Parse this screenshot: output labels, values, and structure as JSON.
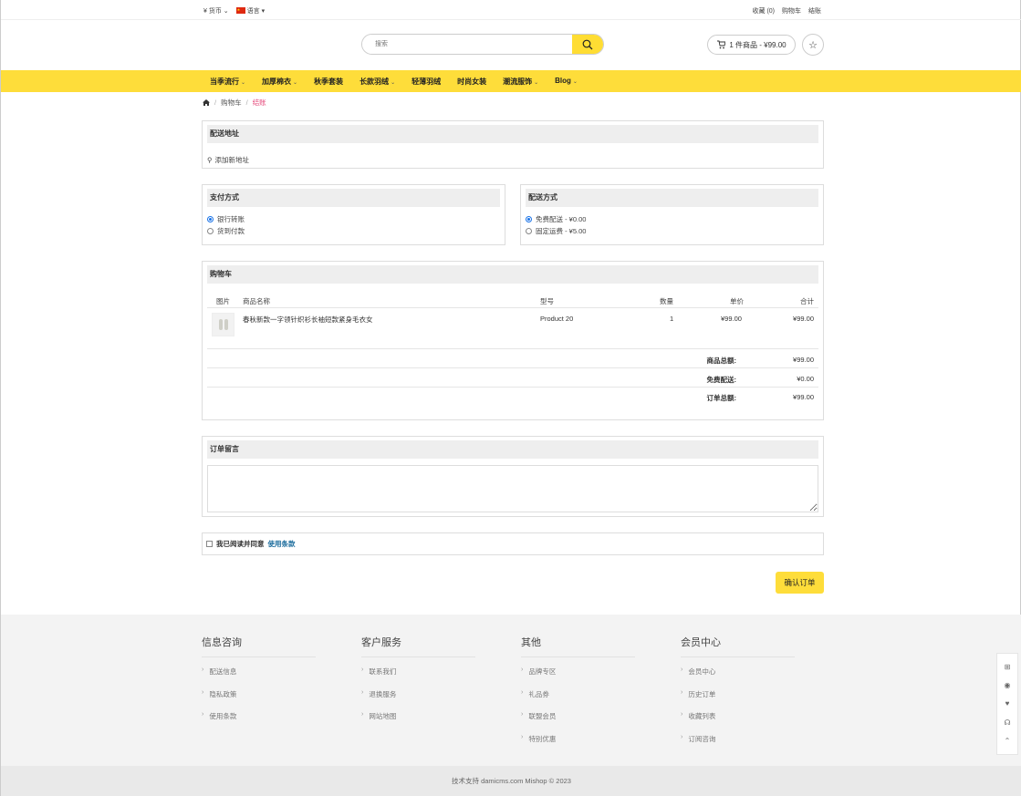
{
  "topbar": {
    "currency": "¥ 货币",
    "language": "语言",
    "favorites": "收藏 (0)",
    "cart": "购物车",
    "checkout": "结账"
  },
  "header": {
    "search_placeholder": "搜索",
    "cart_summary": "1 件商品 - ¥99.00"
  },
  "nav": {
    "items": [
      {
        "label": "当季流行",
        "dropdown": true
      },
      {
        "label": "加厚棉衣",
        "dropdown": true
      },
      {
        "label": "秋季套装",
        "dropdown": false
      },
      {
        "label": "长款羽绒",
        "dropdown": true
      },
      {
        "label": "轻薄羽绒",
        "dropdown": false
      },
      {
        "label": "时尚女装",
        "dropdown": false
      },
      {
        "label": "潮流服饰",
        "dropdown": true
      },
      {
        "label": "Blog",
        "dropdown": true
      }
    ]
  },
  "breadcrumb": {
    "home_icon": "home-icon",
    "cart": "购物车",
    "current": "结账"
  },
  "shipping_address": {
    "title": "配送地址",
    "add_new": "添加新地址"
  },
  "payment": {
    "title": "支付方式",
    "options": [
      {
        "label": "银行转账",
        "selected": true
      },
      {
        "label": "货到付款",
        "selected": false
      }
    ]
  },
  "delivery": {
    "title": "配送方式",
    "options": [
      {
        "label": "免费配送 - ¥0.00",
        "selected": true
      },
      {
        "label": "固定运费 - ¥5.00",
        "selected": false
      }
    ]
  },
  "cart": {
    "title": "购物车",
    "columns": {
      "image": "图片",
      "name": "商品名称",
      "model": "型号",
      "qty": "数量",
      "price": "单价",
      "total": "合计"
    },
    "items": [
      {
        "name": "春秋新款一字领针织衫长袖短款紧身毛衣女",
        "model": "Product 20",
        "qty": "1",
        "price": "¥99.00",
        "total": "¥99.00"
      }
    ],
    "summary": [
      {
        "label": "商品总额:",
        "value": "¥99.00"
      },
      {
        "label": "免费配送:",
        "value": "¥0.00"
      },
      {
        "label": "订单总额:",
        "value": "¥99.00"
      }
    ]
  },
  "comment": {
    "title": "订单留言",
    "value": ""
  },
  "agree": {
    "text": "我已阅读并同意",
    "link": "使用条款"
  },
  "confirm_label": "确认订单",
  "footer": {
    "columns": [
      {
        "title": "信息咨询",
        "links": [
          "配送信息",
          "隐私政策",
          "使用条款"
        ]
      },
      {
        "title": "客户服务",
        "links": [
          "联系我们",
          "退换服务",
          "网站地图"
        ]
      },
      {
        "title": "其他",
        "links": [
          "品牌专区",
          "礼品券",
          "联盟会员",
          "特别优惠"
        ]
      },
      {
        "title": "会员中心",
        "links": [
          "会员中心",
          "历史订单",
          "收藏列表",
          "订阅咨询"
        ]
      }
    ],
    "copyright": "技术支持 damicms.com Mishop © 2023"
  },
  "colors": {
    "accent": "#fedd3a",
    "breadcrumb_active": "#e5487a",
    "link": "#1a6b9c"
  }
}
